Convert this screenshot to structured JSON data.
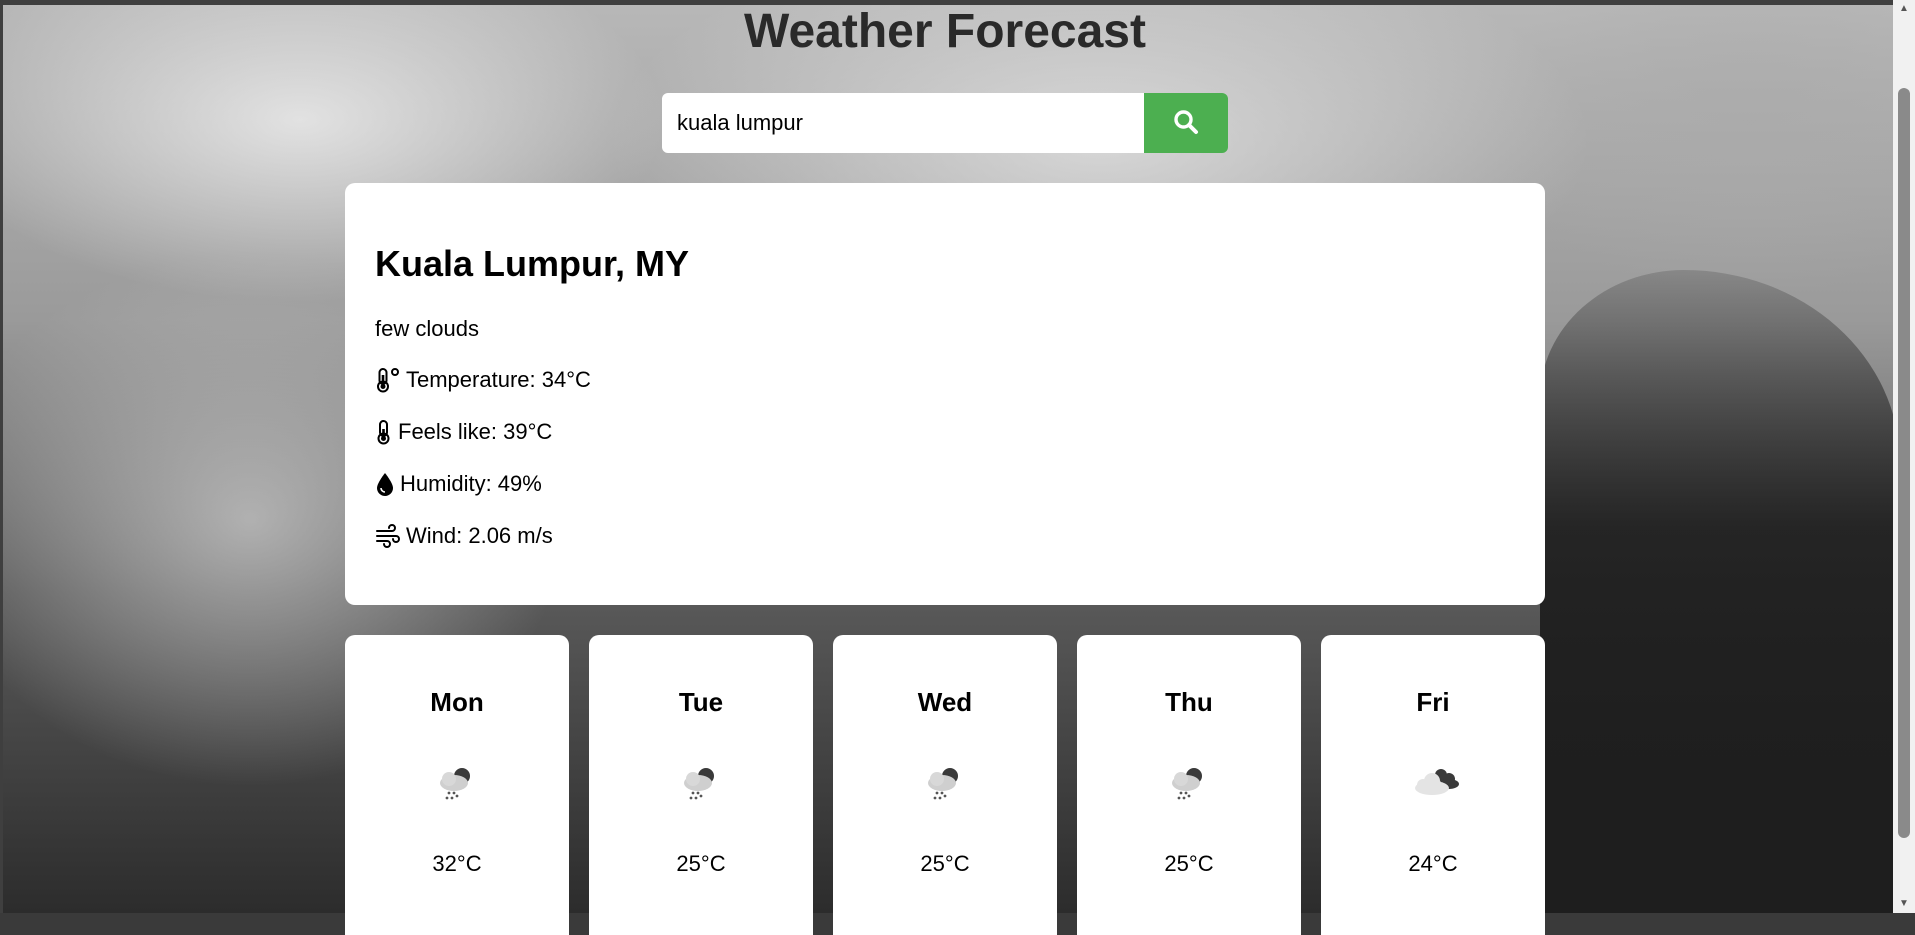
{
  "page": {
    "title": "Weather Forecast"
  },
  "search": {
    "value": "kuala lumpur",
    "button_icon": "search-icon",
    "button_color": "#4caf50"
  },
  "current": {
    "location": "Kuala Lumpur, MY",
    "description": "few clouds",
    "temperature": {
      "icon": "thermometer-icon",
      "text": "Temperature: 34°C"
    },
    "feels_like": {
      "icon": "thermometer-half-icon",
      "text": "Feels like: 39°C"
    },
    "humidity": {
      "icon": "droplet-icon",
      "text": "Humidity: 49%"
    },
    "wind": {
      "icon": "wind-icon",
      "text": "Wind: 2.06 m/s"
    }
  },
  "forecast": [
    {
      "day": "Mon",
      "icon": "rain-cloud-icon",
      "temp": "32°C"
    },
    {
      "day": "Tue",
      "icon": "rain-cloud-icon",
      "temp": "25°C"
    },
    {
      "day": "Wed",
      "icon": "rain-cloud-icon",
      "temp": "25°C"
    },
    {
      "day": "Thu",
      "icon": "rain-cloud-icon",
      "temp": "25°C"
    },
    {
      "day": "Fri",
      "icon": "broken-clouds-icon",
      "temp": "24°C"
    }
  ]
}
